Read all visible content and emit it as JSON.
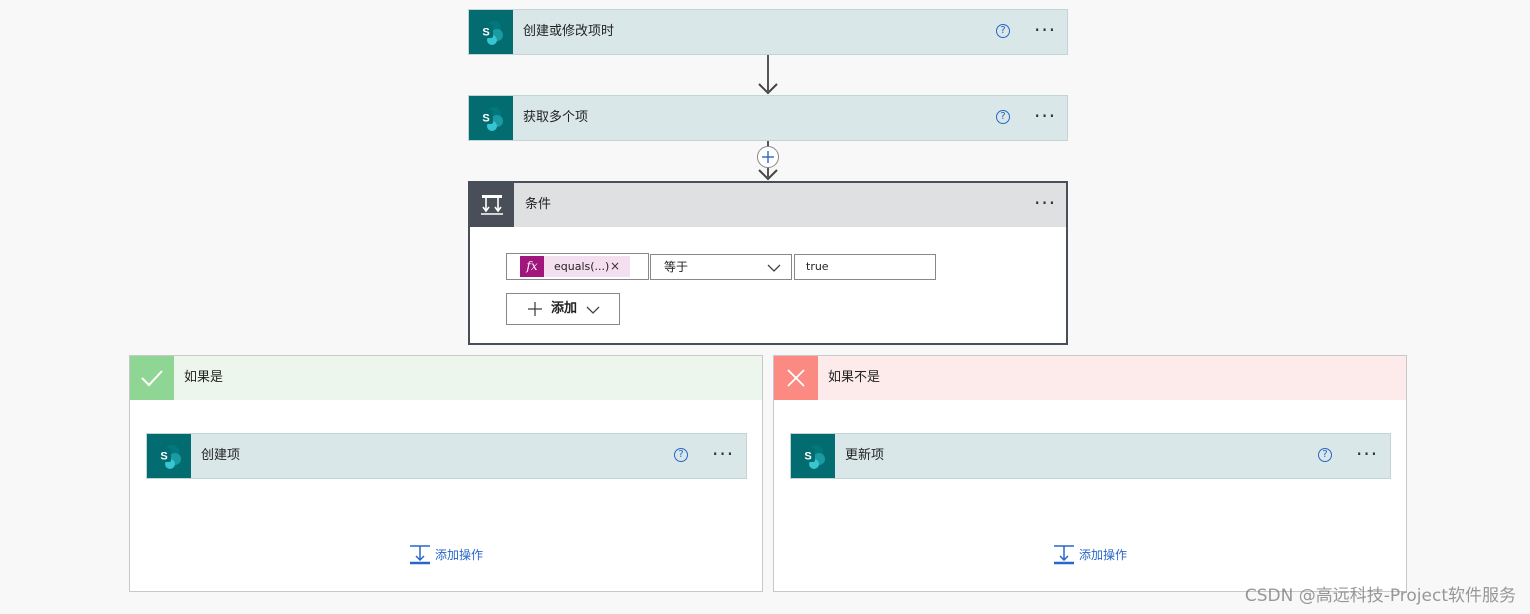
{
  "steps": {
    "trigger": {
      "title": "创建或修改项时",
      "icon": "sharepoint-icon"
    },
    "get_items": {
      "title": "获取多个项",
      "icon": "sharepoint-icon"
    }
  },
  "condition": {
    "title": "条件",
    "icon": "condition-icon",
    "expression_token": "equals(...)",
    "token_icon": "fx",
    "token_remove": "×",
    "operator": "等于",
    "value": "true",
    "add_label": "添加"
  },
  "branches": {
    "yes": {
      "title": "如果是",
      "color": "#8fd694",
      "header_bg": "#edf6ed",
      "action_title": "创建项",
      "add_action": "添加操作"
    },
    "no": {
      "title": "如果不是",
      "color": "#fa8a82",
      "header_bg": "#fdeaea",
      "action_title": "更新项",
      "add_action": "添加操作"
    }
  },
  "common": {
    "help_glyph": "?",
    "more_glyph": "···"
  },
  "watermark": "CSDN @高远科技-Project软件服务"
}
